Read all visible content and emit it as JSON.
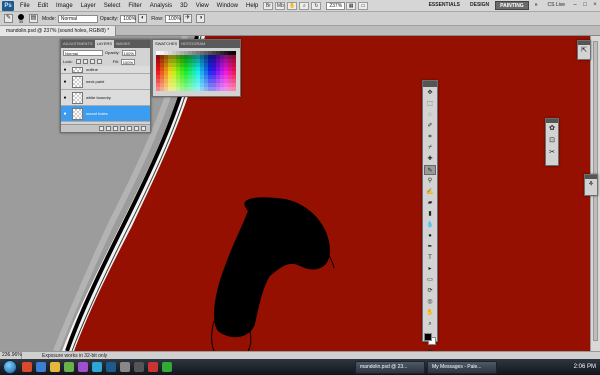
{
  "menubar": {
    "logo": "Ps",
    "menus": [
      "File",
      "Edit",
      "Image",
      "Layer",
      "Select",
      "Filter",
      "Analysis",
      "3D",
      "View",
      "Window",
      "Help"
    ],
    "zoom": "237%",
    "workspaces": [
      "ESSENTIALS",
      "DESIGN",
      "PAINTING"
    ],
    "overflow": "»",
    "cslive": "CS Live",
    "window_controls": [
      "–",
      "□",
      "×"
    ]
  },
  "options": {
    "brush_size": "35",
    "mode_label": "Mode:",
    "mode_value": "Normal",
    "opacity_label": "Opacity:",
    "opacity_value": "100%",
    "flow_label": "Flow:",
    "flow_value": "100%"
  },
  "document": {
    "tab_title": "mandolin.psd @ 237% (sound holes, RGB/8) *"
  },
  "layers_panel": {
    "tabs": [
      "ADJUSTMENTS",
      "LAYERS",
      "MASKS"
    ],
    "blend_mode": "Normal",
    "opacity_label": "Opacity:",
    "opacity_value": "100%",
    "lock_label": "Lock:",
    "fill_label": "Fill:",
    "fill_value": "100%",
    "layers": [
      {
        "name": "outline",
        "selected": false
      },
      {
        "name": "neck paint",
        "selected": false
      },
      {
        "name": "white boundry",
        "selected": false
      },
      {
        "name": "sound holes",
        "selected": true
      }
    ]
  },
  "swatches_panel": {
    "tabs": [
      "SWATCHES",
      "HISTOGRAM"
    ]
  },
  "statusbar": {
    "zoom": "236.96%",
    "message": "Exposure works in 32-bit only"
  },
  "taskbar": {
    "buttons": [
      "mandolin.psd @ 23...",
      "My Messages - Pale..."
    ],
    "clock": "2:06 PM"
  },
  "colors": {
    "canvas_red": "#951000",
    "selection_blue": "#3c9df0"
  }
}
